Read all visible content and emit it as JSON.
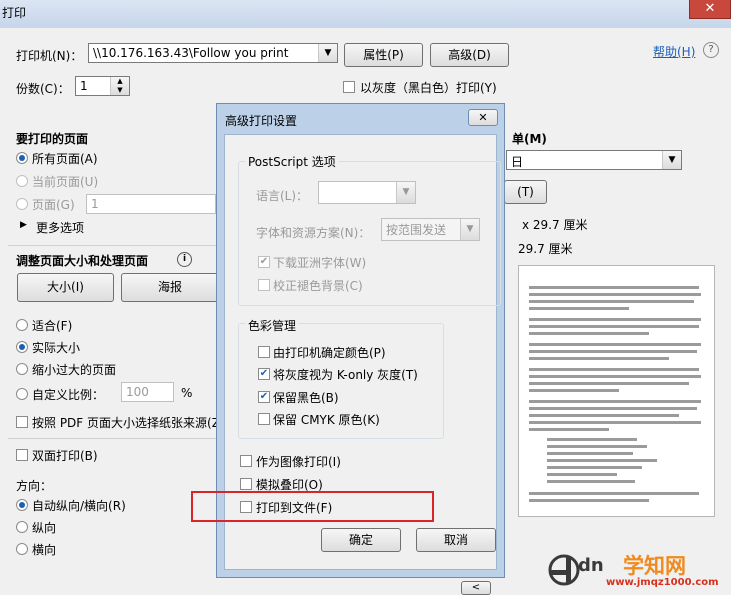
{
  "window": {
    "title": "打印",
    "close_icon": "✕"
  },
  "printer": {
    "label": "打印机(N)：",
    "selected": "\\\\10.176.163.43\\Follow you print",
    "properties_button": "属性(P)",
    "advanced_button": "高级(D)",
    "help_link": "帮助(H)",
    "help_icon": "?"
  },
  "copies": {
    "label": "份数(C)：",
    "value": "1"
  },
  "grayscale": {
    "label": "以灰度（黑白色）打印(Y)",
    "checked": false
  },
  "pages_to_print": {
    "title": "要打印的页面",
    "all_pages": "所有页面(A)",
    "current_page": "当前页面(U)",
    "pages": "页面(G)",
    "pages_value": "1",
    "more_options": "更多选项"
  },
  "page_sizing": {
    "title": "调整页面大小和处理页面",
    "size_button": "大小(I)",
    "poster_button": "海报",
    "fit": "适合(F)",
    "actual_size": "实际大小",
    "shrink_oversized": "缩小过大的页面",
    "custom_scale": "自定义比例：",
    "scale_value": "100",
    "scale_unit": "%",
    "choose_paper_source": "按照 PDF 页面大小选择纸张来源(Z"
  },
  "duplex": {
    "label": "双面打印(B)"
  },
  "orientation": {
    "title": "方向：",
    "auto": "自动纵向/横向(R)",
    "portrait": "纵向",
    "landscape": "横向"
  },
  "right_panel": {
    "title_fragment": "单(M)",
    "combo_fragment": "日",
    "button_fragment": "(T)",
    "size_line1": "x 29.7 厘米",
    "size_line2": "29.7 厘米",
    "prev_page": "<"
  },
  "advanced_dialog": {
    "title": "高级打印设置",
    "close_icon": "✕",
    "postscript": {
      "title": "PostScript 选项",
      "language_label": "语言(L)：",
      "language_value": "",
      "font_policy_label": "字体和资源方案(N)：",
      "font_policy_value": "按范围发送",
      "download_asian_fonts": "下载亚洲字体(W)",
      "correct_gray_background": "校正褪色背景(C)"
    },
    "color": {
      "title": "色彩管理",
      "printer_determines": "由打印机确定颜色(P)",
      "k_only_gray": "将灰度视为 K-only 灰度(T)",
      "preserve_black": "保留黑色(B)",
      "preserve_cmyk": "保留 CMYK 原色(K)"
    },
    "print_as_image": "作为图像打印(I)",
    "simulate_overprint": "模拟叠印(O)",
    "print_to_file": "打印到文件(F)",
    "ok_button": "确定",
    "cancel_button": "取消"
  },
  "watermark": {
    "logo_text": "dn",
    "site_name": "学知网",
    "url": "www.jmqz1000.com"
  },
  "colors": {
    "accent": "#1c5fb5",
    "highlight": "#d9252a",
    "watermark_orange": "#f08a1c",
    "watermark_red": "#d4321e"
  }
}
